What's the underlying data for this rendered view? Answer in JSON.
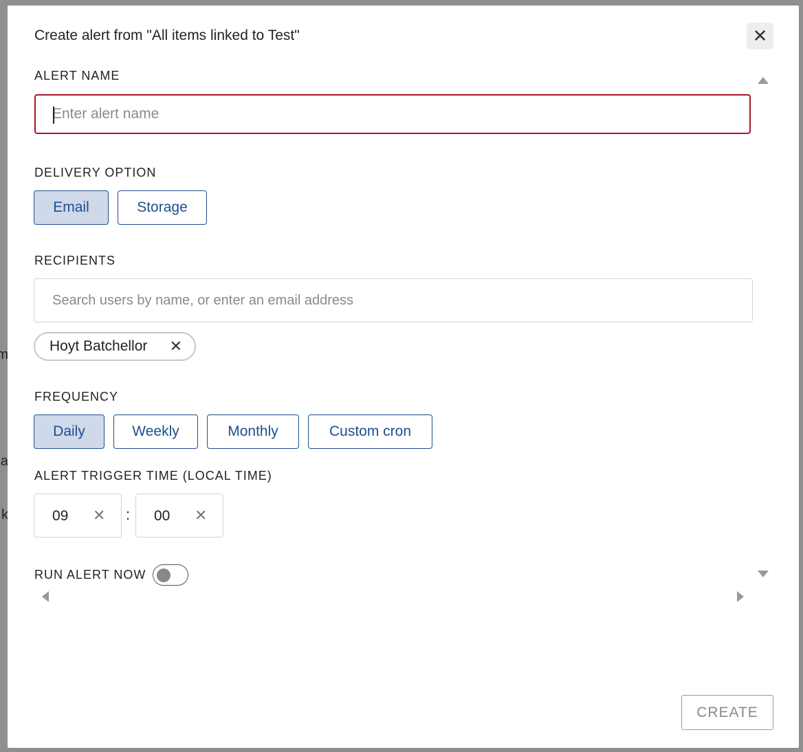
{
  "backdrop": {
    "fragments": [
      "m",
      "a",
      "k"
    ]
  },
  "dialog": {
    "title": "Create alert from \"All items linked to Test\"",
    "close_icon": "close-icon"
  },
  "alert_name": {
    "label": "ALERT NAME",
    "value": "",
    "placeholder": "Enter alert name"
  },
  "delivery": {
    "label": "DELIVERY OPTION",
    "options": [
      "Email",
      "Storage"
    ],
    "selected": "Email"
  },
  "recipients": {
    "label": "RECIPIENTS",
    "placeholder": "Search users by name, or enter an email address",
    "chips": [
      "Hoyt Batchellor"
    ]
  },
  "frequency": {
    "label": "FREQUENCY",
    "options": [
      "Daily",
      "Weekly",
      "Monthly",
      "Custom cron"
    ],
    "selected": "Daily"
  },
  "trigger_time": {
    "label": "ALERT TRIGGER TIME (LOCAL TIME)",
    "hour": "09",
    "minute": "00",
    "separator": ":"
  },
  "run_now": {
    "label": "RUN ALERT NOW",
    "enabled": false
  },
  "footer": {
    "create_label": "CREATE"
  },
  "colors": {
    "accent": "#1f4e8c",
    "selected_bg": "#cfd9ea",
    "error_border": "#a8132c"
  }
}
